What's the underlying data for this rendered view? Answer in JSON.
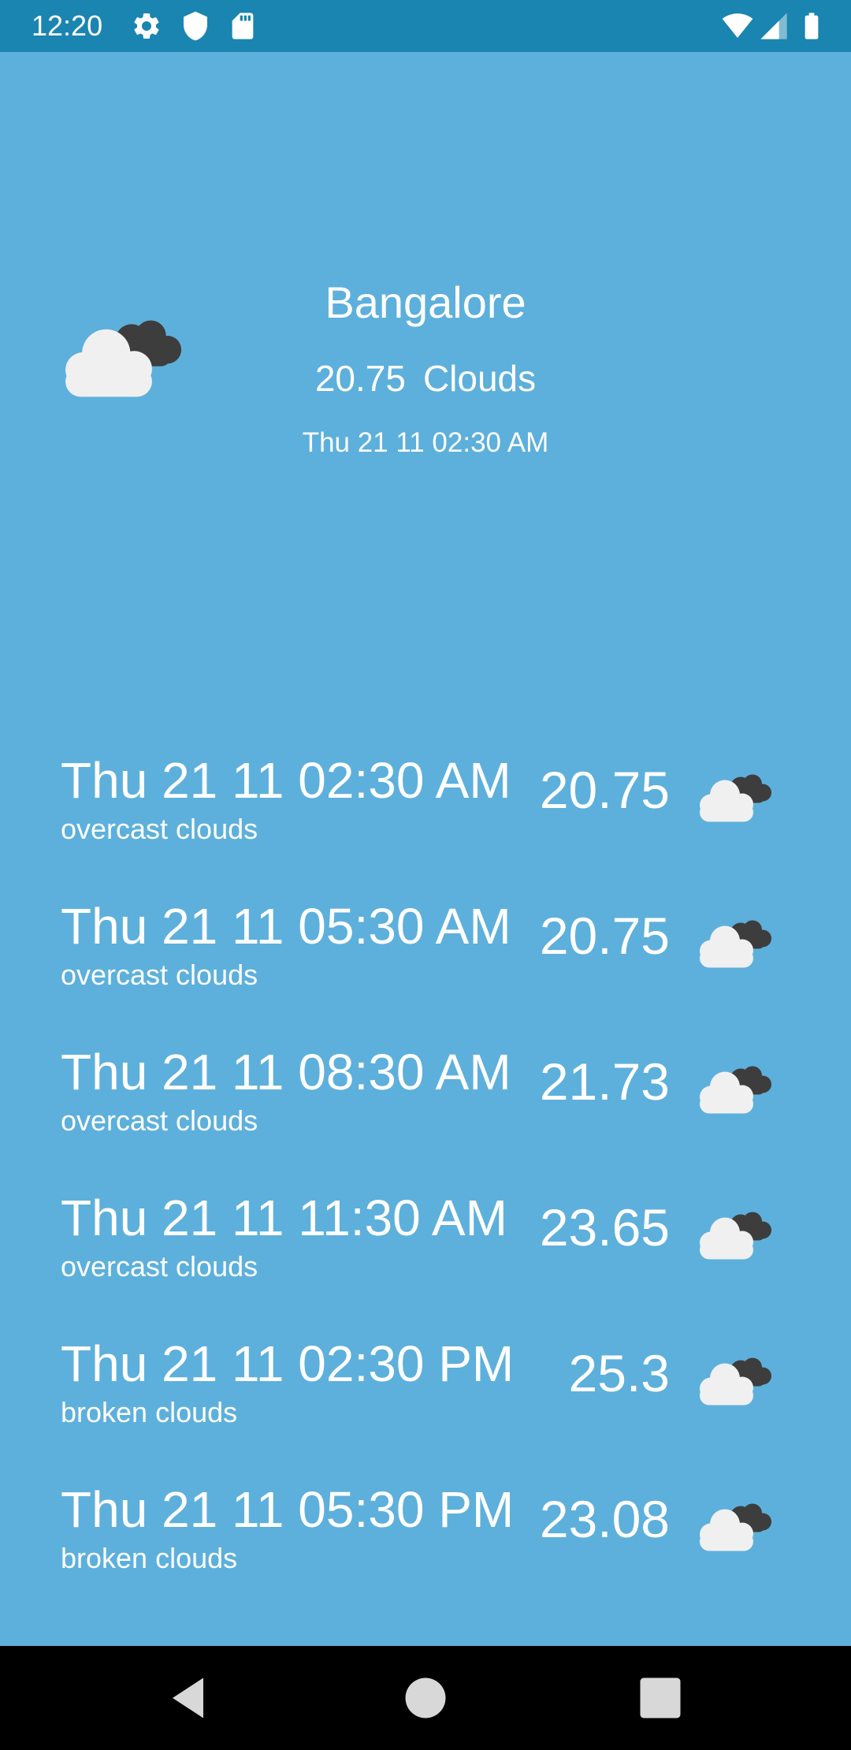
{
  "status_bar": {
    "time": "12:20",
    "left_icons": [
      "settings-icon",
      "shield-icon",
      "sd-card-icon"
    ],
    "right_icons": [
      "wifi-icon",
      "cell-signal-icon",
      "battery-icon"
    ],
    "background": "#1a85b0"
  },
  "current": {
    "city": "Bangalore",
    "temperature": "20.75",
    "condition": "Clouds",
    "datetime": "Thu 21 11 02:30 AM",
    "icon": "overcast-clouds-icon"
  },
  "forecast": [
    {
      "datetime": "Thu 21 11 02:30 AM",
      "description": "overcast clouds",
      "temperature": "20.75",
      "icon": "overcast-clouds-icon"
    },
    {
      "datetime": "Thu 21 11 05:30 AM",
      "description": "overcast clouds",
      "temperature": "20.75",
      "icon": "overcast-clouds-icon"
    },
    {
      "datetime": "Thu 21 11 08:30 AM",
      "description": "overcast clouds",
      "temperature": "21.73",
      "icon": "overcast-clouds-icon"
    },
    {
      "datetime": "Thu 21 11 11:30 AM",
      "description": "overcast clouds",
      "temperature": "23.65",
      "icon": "overcast-clouds-icon"
    },
    {
      "datetime": "Thu 21 11 02:30 PM",
      "description": "broken clouds",
      "temperature": "25.3",
      "icon": "broken-clouds-icon"
    },
    {
      "datetime": "Thu 21 11 05:30 PM",
      "description": "broken clouds",
      "temperature": "23.08",
      "icon": "broken-clouds-icon"
    }
  ],
  "nav_bar": {
    "buttons": [
      "back-icon",
      "home-icon",
      "recents-icon"
    ]
  },
  "colors": {
    "background": "#5db0db",
    "status_bar": "#1a85b0",
    "nav_bar": "#000000",
    "text": "#ffffff"
  }
}
